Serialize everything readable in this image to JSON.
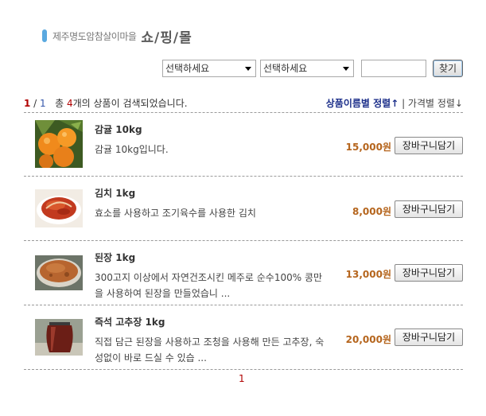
{
  "header": {
    "village": "제주명도암참살이마을",
    "mall": "쇼/핑/몰"
  },
  "search": {
    "select1": "선택하세요",
    "select2": "선택하세요",
    "query": "",
    "button": "찾기"
  },
  "result": {
    "page_current": "1",
    "page_sep": " / ",
    "page_total": "1",
    "prefix": "총 ",
    "count": "4",
    "suffix": "개의 상품이 검색되었습니다.",
    "sort_name": "상품이름별 정렬↑",
    "sort_divider": " | ",
    "sort_price": "가격별 정렬↓"
  },
  "products": [
    {
      "name": "감귤 10kg",
      "desc": "감귤 10kg입니다.",
      "price": "15,000원",
      "cart": "장바구니담기",
      "image": "tangerines-photo"
    },
    {
      "name": "김치 1kg",
      "desc": "효소를 사용하고 조기육수를 사용한 김치",
      "price": "8,000원",
      "cart": "장바구니담기",
      "image": "kimchi-photo"
    },
    {
      "name": "된장 1kg",
      "desc": "300고지 이상에서 자연건조시킨 메주로 순수100% 콩만을 사용하여 된장을 만들었습니 ...",
      "price": "13,000원",
      "cart": "장바구니담기",
      "image": "doenjang-photo"
    },
    {
      "name": "즉석 고추장 1kg",
      "desc": "직접 담근 된장을 사용하고 조청을 사용해 만든 고추장, 숙성없이 바로 드실 수 있습 ...",
      "price": "20,000원",
      "cart": "장바구니담기",
      "image": "gochujang-jar-photo"
    }
  ],
  "pagination": {
    "page": "1"
  }
}
